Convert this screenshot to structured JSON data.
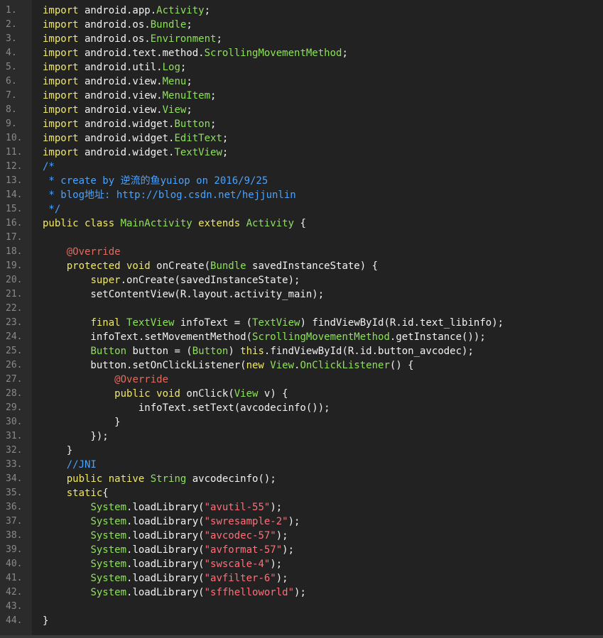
{
  "editor": {
    "lines": [
      {
        "n": "1.",
        "tokens": [
          {
            "t": "import",
            "c": "kw"
          },
          {
            "t": " android.app.",
            "c": "tx"
          },
          {
            "t": "Activity",
            "c": "ty"
          },
          {
            "t": ";",
            "c": "tx"
          }
        ]
      },
      {
        "n": "2.",
        "tokens": [
          {
            "t": "import",
            "c": "kw"
          },
          {
            "t": " android.os.",
            "c": "tx"
          },
          {
            "t": "Bundle",
            "c": "ty"
          },
          {
            "t": ";",
            "c": "tx"
          }
        ]
      },
      {
        "n": "3.",
        "tokens": [
          {
            "t": "import",
            "c": "kw"
          },
          {
            "t": " android.os.",
            "c": "tx"
          },
          {
            "t": "Environment",
            "c": "ty"
          },
          {
            "t": ";",
            "c": "tx"
          }
        ]
      },
      {
        "n": "4.",
        "tokens": [
          {
            "t": "import",
            "c": "kw"
          },
          {
            "t": " android.text.method.",
            "c": "tx"
          },
          {
            "t": "ScrollingMovementMethod",
            "c": "ty"
          },
          {
            "t": ";",
            "c": "tx"
          }
        ]
      },
      {
        "n": "5.",
        "tokens": [
          {
            "t": "import",
            "c": "kw"
          },
          {
            "t": " android.util.",
            "c": "tx"
          },
          {
            "t": "Log",
            "c": "ty"
          },
          {
            "t": ";",
            "c": "tx"
          }
        ]
      },
      {
        "n": "6.",
        "tokens": [
          {
            "t": "import",
            "c": "kw"
          },
          {
            "t": " android.view.",
            "c": "tx"
          },
          {
            "t": "Menu",
            "c": "ty"
          },
          {
            "t": ";",
            "c": "tx"
          }
        ]
      },
      {
        "n": "7.",
        "tokens": [
          {
            "t": "import",
            "c": "kw"
          },
          {
            "t": " android.view.",
            "c": "tx"
          },
          {
            "t": "MenuItem",
            "c": "ty"
          },
          {
            "t": ";",
            "c": "tx"
          }
        ]
      },
      {
        "n": "8.",
        "tokens": [
          {
            "t": "import",
            "c": "kw"
          },
          {
            "t": " android.view.",
            "c": "tx"
          },
          {
            "t": "View",
            "c": "ty"
          },
          {
            "t": ";",
            "c": "tx"
          }
        ]
      },
      {
        "n": "9.",
        "tokens": [
          {
            "t": "import",
            "c": "kw"
          },
          {
            "t": " android.widget.",
            "c": "tx"
          },
          {
            "t": "Button",
            "c": "ty"
          },
          {
            "t": ";",
            "c": "tx"
          }
        ]
      },
      {
        "n": "10.",
        "tokens": [
          {
            "t": "import",
            "c": "kw"
          },
          {
            "t": " android.widget.",
            "c": "tx"
          },
          {
            "t": "EditText",
            "c": "ty"
          },
          {
            "t": ";",
            "c": "tx"
          }
        ]
      },
      {
        "n": "11.",
        "tokens": [
          {
            "t": "import",
            "c": "kw"
          },
          {
            "t": " android.widget.",
            "c": "tx"
          },
          {
            "t": "TextView",
            "c": "ty"
          },
          {
            "t": ";",
            "c": "tx"
          }
        ]
      },
      {
        "n": "12.",
        "tokens": [
          {
            "t": "/*",
            "c": "cm"
          }
        ]
      },
      {
        "n": "13.",
        "tokens": [
          {
            "t": " * create by 逆流的鱼yuiop on 2016/9/25",
            "c": "cm"
          }
        ]
      },
      {
        "n": "14.",
        "tokens": [
          {
            "t": " * blog地址: http://blog.csdn.net/hejjunlin",
            "c": "cm"
          }
        ]
      },
      {
        "n": "15.",
        "tokens": [
          {
            "t": " */",
            "c": "cm"
          }
        ]
      },
      {
        "n": "16.",
        "tokens": [
          {
            "t": "public class ",
            "c": "kw"
          },
          {
            "t": "MainActivity",
            "c": "ty"
          },
          {
            "t": " extends ",
            "c": "kw"
          },
          {
            "t": "Activity",
            "c": "ty"
          },
          {
            "t": " {",
            "c": "tx"
          }
        ]
      },
      {
        "n": "17.",
        "tokens": []
      },
      {
        "n": "18.",
        "tokens": [
          {
            "t": "    ",
            "c": "tx"
          },
          {
            "t": "@Override",
            "c": "an"
          }
        ]
      },
      {
        "n": "19.",
        "tokens": [
          {
            "t": "    ",
            "c": "tx"
          },
          {
            "t": "protected void ",
            "c": "kw"
          },
          {
            "t": "onCreate(",
            "c": "tx"
          },
          {
            "t": "Bundle",
            "c": "ty"
          },
          {
            "t": " savedInstanceState) {",
            "c": "tx"
          }
        ]
      },
      {
        "n": "20.",
        "tokens": [
          {
            "t": "        ",
            "c": "tx"
          },
          {
            "t": "super",
            "c": "kw"
          },
          {
            "t": ".onCreate(savedInstanceState);",
            "c": "tx"
          }
        ]
      },
      {
        "n": "21.",
        "tokens": [
          {
            "t": "        setContentView(R.layout.activity_main);",
            "c": "tx"
          }
        ]
      },
      {
        "n": "22.",
        "tokens": []
      },
      {
        "n": "23.",
        "tokens": [
          {
            "t": "        ",
            "c": "tx"
          },
          {
            "t": "final ",
            "c": "kw"
          },
          {
            "t": "TextView",
            "c": "ty"
          },
          {
            "t": " infoText = (",
            "c": "tx"
          },
          {
            "t": "TextView",
            "c": "ty"
          },
          {
            "t": ") findViewById(R.id.text_libinfo);",
            "c": "tx"
          }
        ]
      },
      {
        "n": "24.",
        "tokens": [
          {
            "t": "        infoText.setMovementMethod(",
            "c": "tx"
          },
          {
            "t": "ScrollingMovementMethod",
            "c": "ty"
          },
          {
            "t": ".getInstance());",
            "c": "tx"
          }
        ]
      },
      {
        "n": "25.",
        "tokens": [
          {
            "t": "        ",
            "c": "tx"
          },
          {
            "t": "Button",
            "c": "ty"
          },
          {
            "t": " button = (",
            "c": "tx"
          },
          {
            "t": "Button",
            "c": "ty"
          },
          {
            "t": ") ",
            "c": "tx"
          },
          {
            "t": "this",
            "c": "kw"
          },
          {
            "t": ".findViewById(R.id.button_avcodec);",
            "c": "tx"
          }
        ]
      },
      {
        "n": "26.",
        "tokens": [
          {
            "t": "        button.setOnClickListener(",
            "c": "tx"
          },
          {
            "t": "new ",
            "c": "kw"
          },
          {
            "t": "View",
            "c": "ty"
          },
          {
            "t": ".",
            "c": "tx"
          },
          {
            "t": "OnClickListener",
            "c": "ty"
          },
          {
            "t": "() {",
            "c": "tx"
          }
        ]
      },
      {
        "n": "27.",
        "tokens": [
          {
            "t": "            ",
            "c": "tx"
          },
          {
            "t": "@Override",
            "c": "an"
          }
        ]
      },
      {
        "n": "28.",
        "tokens": [
          {
            "t": "            ",
            "c": "tx"
          },
          {
            "t": "public void ",
            "c": "kw"
          },
          {
            "t": "onClick(",
            "c": "tx"
          },
          {
            "t": "View",
            "c": "ty"
          },
          {
            "t": " v) {",
            "c": "tx"
          }
        ]
      },
      {
        "n": "29.",
        "tokens": [
          {
            "t": "                infoText.setText(avcodecinfo());",
            "c": "tx"
          }
        ]
      },
      {
        "n": "30.",
        "tokens": [
          {
            "t": "            }",
            "c": "tx"
          }
        ]
      },
      {
        "n": "31.",
        "tokens": [
          {
            "t": "        });",
            "c": "tx"
          }
        ]
      },
      {
        "n": "32.",
        "tokens": [
          {
            "t": "    }",
            "c": "tx"
          }
        ]
      },
      {
        "n": "33.",
        "tokens": [
          {
            "t": "    ",
            "c": "tx"
          },
          {
            "t": "//JNI",
            "c": "cm"
          }
        ]
      },
      {
        "n": "34.",
        "tokens": [
          {
            "t": "    ",
            "c": "tx"
          },
          {
            "t": "public native ",
            "c": "kw"
          },
          {
            "t": "String",
            "c": "ty"
          },
          {
            "t": " avcodecinfo();",
            "c": "tx"
          }
        ]
      },
      {
        "n": "35.",
        "tokens": [
          {
            "t": "    ",
            "c": "tx"
          },
          {
            "t": "static",
            "c": "kw"
          },
          {
            "t": "{",
            "c": "tx"
          }
        ]
      },
      {
        "n": "36.",
        "tokens": [
          {
            "t": "        ",
            "c": "tx"
          },
          {
            "t": "System",
            "c": "ty"
          },
          {
            "t": ".loadLibrary(",
            "c": "tx"
          },
          {
            "t": "\"avutil-55\"",
            "c": "st"
          },
          {
            "t": ");",
            "c": "tx"
          }
        ]
      },
      {
        "n": "37.",
        "tokens": [
          {
            "t": "        ",
            "c": "tx"
          },
          {
            "t": "System",
            "c": "ty"
          },
          {
            "t": ".loadLibrary(",
            "c": "tx"
          },
          {
            "t": "\"swresample-2\"",
            "c": "st"
          },
          {
            "t": ");",
            "c": "tx"
          }
        ]
      },
      {
        "n": "38.",
        "tokens": [
          {
            "t": "        ",
            "c": "tx"
          },
          {
            "t": "System",
            "c": "ty"
          },
          {
            "t": ".loadLibrary(",
            "c": "tx"
          },
          {
            "t": "\"avcodec-57\"",
            "c": "st"
          },
          {
            "t": ");",
            "c": "tx"
          }
        ]
      },
      {
        "n": "39.",
        "tokens": [
          {
            "t": "        ",
            "c": "tx"
          },
          {
            "t": "System",
            "c": "ty"
          },
          {
            "t": ".loadLibrary(",
            "c": "tx"
          },
          {
            "t": "\"avformat-57\"",
            "c": "st"
          },
          {
            "t": ");",
            "c": "tx"
          }
        ]
      },
      {
        "n": "40.",
        "tokens": [
          {
            "t": "        ",
            "c": "tx"
          },
          {
            "t": "System",
            "c": "ty"
          },
          {
            "t": ".loadLibrary(",
            "c": "tx"
          },
          {
            "t": "\"swscale-4\"",
            "c": "st"
          },
          {
            "t": ");",
            "c": "tx"
          }
        ]
      },
      {
        "n": "41.",
        "tokens": [
          {
            "t": "        ",
            "c": "tx"
          },
          {
            "t": "System",
            "c": "ty"
          },
          {
            "t": ".loadLibrary(",
            "c": "tx"
          },
          {
            "t": "\"avfilter-6\"",
            "c": "st"
          },
          {
            "t": ");",
            "c": "tx"
          }
        ]
      },
      {
        "n": "42.",
        "tokens": [
          {
            "t": "        ",
            "c": "tx"
          },
          {
            "t": "System",
            "c": "ty"
          },
          {
            "t": ".loadLibrary(",
            "c": "tx"
          },
          {
            "t": "\"sffhelloworld\"",
            "c": "st"
          },
          {
            "t": ");",
            "c": "tx"
          }
        ]
      },
      {
        "n": "43.",
        "tokens": []
      },
      {
        "n": "44.",
        "tokens": [
          {
            "t": "}",
            "c": "tx"
          }
        ]
      }
    ]
  }
}
